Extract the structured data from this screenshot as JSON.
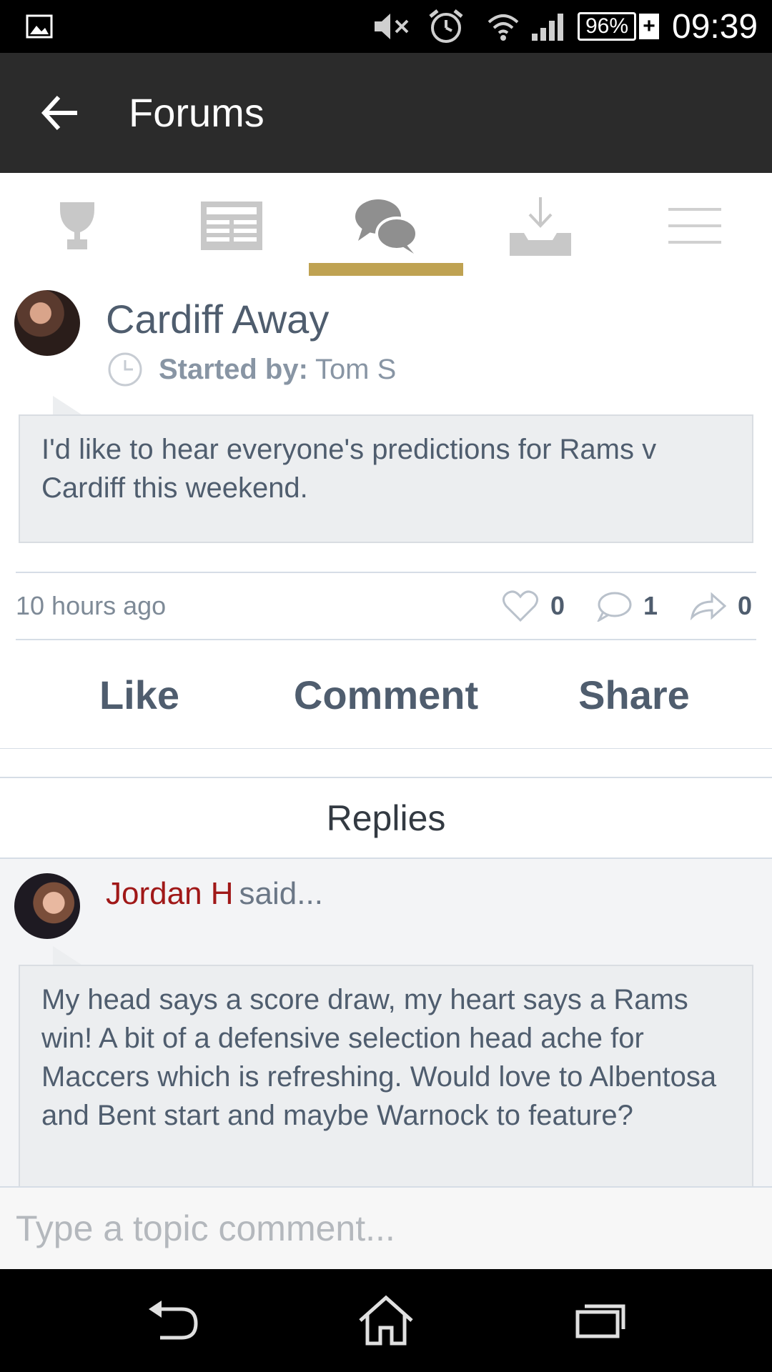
{
  "status_bar": {
    "battery": "96%",
    "battery_plus": "+",
    "time": "09:39",
    "icons": [
      "gallery-icon",
      "mute-icon",
      "alarm-icon",
      "wifi-icon",
      "signal-icon",
      "battery-icon"
    ]
  },
  "toolbar": {
    "title": "Forums",
    "back_icon": "arrow-left-icon"
  },
  "tabs": {
    "items": [
      {
        "icon": "trophy-icon"
      },
      {
        "icon": "news-icon"
      },
      {
        "icon": "chat-bubbles-icon",
        "active": true
      },
      {
        "icon": "download-tray-icon"
      },
      {
        "icon": "menu-icon"
      }
    ],
    "accent_color": "#bfa252"
  },
  "post": {
    "title": "Cardiff Away",
    "started_by_label": "Started by:",
    "started_by_name": "Tom S",
    "body": "I'd like to hear everyone's predictions for Rams v Cardiff this weekend.",
    "time_ago": "10 hours ago",
    "likes": "0",
    "comments": "1",
    "shares": "0"
  },
  "actions": {
    "like": "Like",
    "comment": "Comment",
    "share": "Share"
  },
  "replies": {
    "header": "Replies",
    "items": [
      {
        "author": "Jordan H",
        "said": "said...",
        "body": "My head says a score draw, my heart says a Rams win! A bit of a defensive selection head ache for Maccers which is refreshing. Would love to Albentosa and Bent start and maybe Warnock to feature?"
      }
    ]
  },
  "comment_input": {
    "placeholder": "Type a topic comment..."
  },
  "colors": {
    "status_bar": "#000000",
    "toolbar": "#2b2b2b",
    "text": "#4f5d6e",
    "author": "#a01818"
  }
}
